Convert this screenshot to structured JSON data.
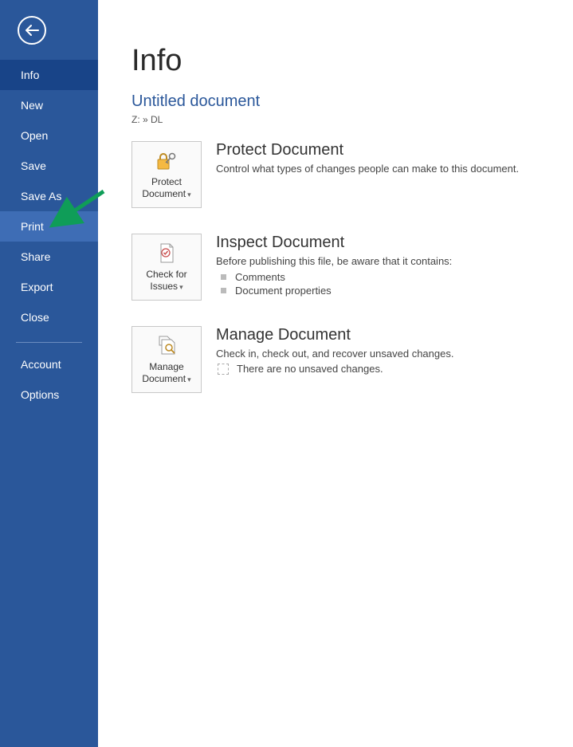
{
  "sidebar": {
    "items": [
      {
        "label": "Info"
      },
      {
        "label": "New"
      },
      {
        "label": "Open"
      },
      {
        "label": "Save"
      },
      {
        "label": "Save As"
      },
      {
        "label": "Print"
      },
      {
        "label": "Share"
      },
      {
        "label": "Export"
      },
      {
        "label": "Close"
      }
    ],
    "footer": [
      {
        "label": "Account"
      },
      {
        "label": "Options"
      }
    ]
  },
  "page": {
    "title": "Info",
    "document_title": "Untitled document",
    "document_path": "Z: » DL"
  },
  "protect": {
    "tile_line1": "Protect",
    "tile_line2": "Document",
    "heading": "Protect Document",
    "desc": "Control what types of changes people can make to this document."
  },
  "inspect": {
    "tile_line1": "Check for",
    "tile_line2": "Issues",
    "heading": "Inspect Document",
    "desc": "Before publishing this file, be aware that it contains:",
    "items": [
      "Comments",
      "Document properties"
    ]
  },
  "manage": {
    "tile_line1": "Manage",
    "tile_line2": "Document",
    "heading": "Manage Document",
    "desc": "Check in, check out, and recover unsaved changes.",
    "unsaved_text": "There are no unsaved changes."
  }
}
